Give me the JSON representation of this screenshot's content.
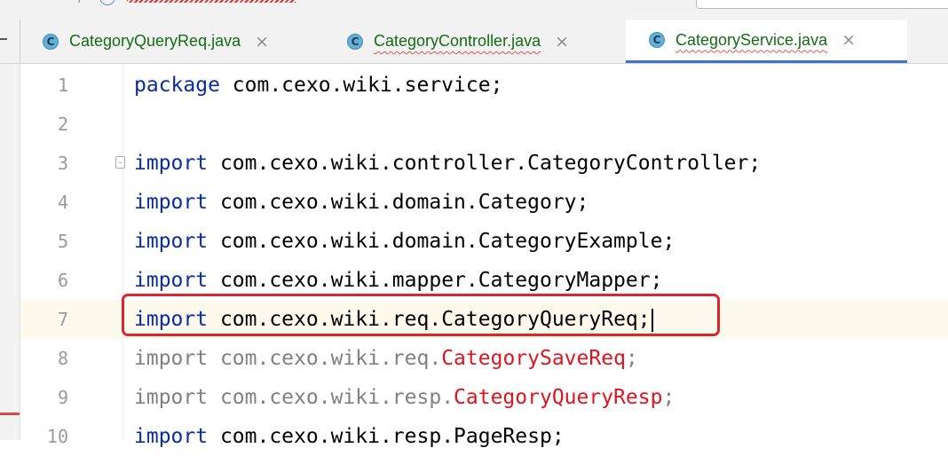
{
  "tabs": [
    {
      "label": "CategoryQueryReq.java",
      "icon": "class-icon",
      "icon_letter": "C",
      "active": false
    },
    {
      "label": "CategoryController.java",
      "icon": "class-icon",
      "icon_letter": "C",
      "active": false
    },
    {
      "label": "CategoryService.java",
      "icon": "class-icon",
      "icon_letter": "C",
      "active": true
    }
  ],
  "close_glyph": "×",
  "editor": {
    "lines": [
      {
        "number": "1",
        "kw": "package",
        "pkg": " com.cexo.wiki.service",
        "cls": "",
        "end": ";"
      },
      {
        "number": "2",
        "kw": "",
        "pkg": "",
        "cls": "",
        "end": ""
      },
      {
        "number": "3",
        "kw": "import",
        "pkg": " com.cexo.wiki.controller.",
        "cls": "CategoryController",
        "end": ";"
      },
      {
        "number": "4",
        "kw": "import",
        "pkg": " com.cexo.wiki.domain.",
        "cls": "Category",
        "end": ";"
      },
      {
        "number": "5",
        "kw": "import",
        "pkg": " com.cexo.wiki.domain.",
        "cls": "CategoryExample",
        "end": ";"
      },
      {
        "number": "6",
        "kw": "import",
        "pkg": " com.cexo.wiki.mapper.",
        "cls": "CategoryMapper",
        "end": ";"
      },
      {
        "number": "7",
        "kw": "import",
        "pkg": " com.cexo.wiki.req.",
        "cls": "CategoryQueryReq",
        "end": ";"
      },
      {
        "number": "8",
        "kw": "import",
        "pkg": " com.cexo.wiki.req.",
        "cls": "CategorySaveReq",
        "end": ";"
      },
      {
        "number": "9",
        "kw": "import",
        "pkg": " com.cexo.wiki.resp.",
        "cls": "CategoryQueryResp",
        "end": ";"
      },
      {
        "number": "10",
        "kw": "import",
        "pkg": " com.cexo.wiki.resp.",
        "cls": "PageResp",
        "end": ";"
      }
    ]
  },
  "colors": {
    "keyword": "#0a2ba8",
    "unresolved": "#e0141e",
    "unused_import": "#808080",
    "highlight_box": "#e0242e",
    "active_tab_underline": "#3d74c4",
    "class_icon": "#62b0d4"
  }
}
